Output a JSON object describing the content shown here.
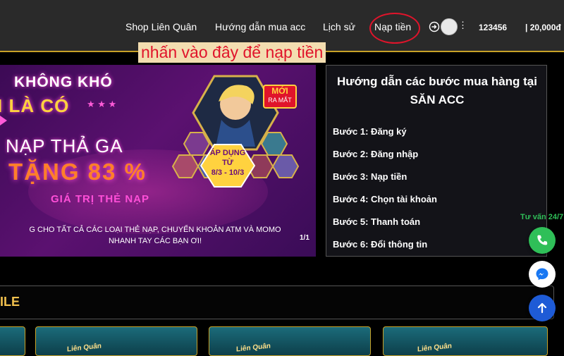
{
  "nav": {
    "items": [
      "Shop Liên Quân",
      "Hướng dẫn mua acc",
      "Lịch sử",
      "Nạp tiền"
    ],
    "username": "123456",
    "balance": "| 20,000đ",
    "login_icon": "login-icon",
    "avatar_icon": "avatar-icon",
    "menu_icon": "more-vertical-icon"
  },
  "annotation": {
    "text": "nhấn vào đây để nạp tiền",
    "color": "#e0142b"
  },
  "banner": {
    "line1": "KHÔNG KHÓ",
    "line2": "I LÀ CÓ",
    "line3": "NẠP THẢ GA",
    "line4": "TẶNG 83 %",
    "line5": "GIÁ TRỊ THẺ NẠP",
    "line6a": "G CHO TẤT CẢ CÁC LOẠI THẺ NẠP, CHUYỂN KHOẢN ATM VÀ MOMO",
    "line6b": "NHANH TAY CÁC BẠN ƠI!",
    "new_badge_top": "MỚI",
    "new_badge_bottom": "RA MẮT",
    "apply_l1": "ÁP DỤNG",
    "apply_l2": "TỪ",
    "apply_l3": "8/3 - 10/3",
    "counter": "1/1"
  },
  "guide": {
    "title": "Hướng dẫn các bước mua hàng tại SĂN ACC",
    "steps": [
      "Bước 1: Đăng ký",
      "Bước 2: Đăng nhập",
      "Bước 3: Nạp tiền",
      "Bước 4: Chọn tài khoản",
      "Bước 5: Thanh toán",
      "Bước 6: Đổi thông tin"
    ]
  },
  "section": {
    "title": "ILE"
  },
  "cards": {
    "label": "Liên Quân"
  },
  "support": {
    "label": "Tư vấn 24/7",
    "buttons": [
      "phone-icon",
      "messenger-icon",
      "arrow-up-icon"
    ]
  },
  "colors": {
    "accent_gold": "#c9a227",
    "highlight_red": "#e0142b",
    "support_green": "#2fbf58",
    "messenger_blue": "#1877f2"
  }
}
